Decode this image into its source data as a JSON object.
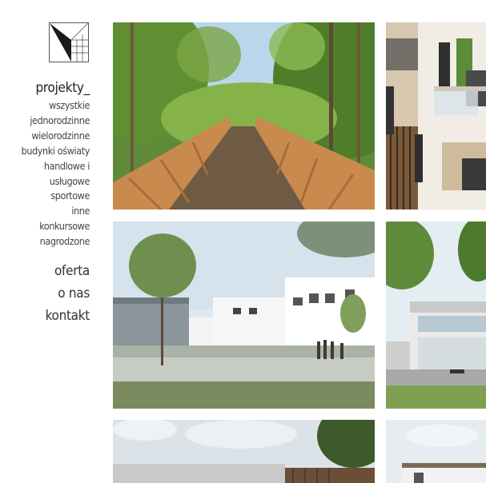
{
  "logo": {
    "icon": "studio-logo-icon"
  },
  "nav": {
    "section_title": "projekty_",
    "categories": [
      "wszystkie",
      "jednorodzinne",
      "wielorodzinne",
      "budynki oświaty",
      "handlowe i",
      "usługowe",
      "sportowe",
      "inne",
      "konkursowe",
      "nagrodzone"
    ],
    "main_links": [
      "oferta",
      "o nas",
      "kontakt"
    ]
  },
  "gallery": {
    "tiles": [
      {
        "subject": "wooden-footbridge-forest"
      },
      {
        "subject": "residential-building-facade"
      },
      {
        "subject": "school-building-render"
      },
      {
        "subject": "commercial-building-render"
      },
      {
        "subject": "industrial-building-render"
      },
      {
        "subject": "flat-roof-building-render"
      }
    ]
  }
}
